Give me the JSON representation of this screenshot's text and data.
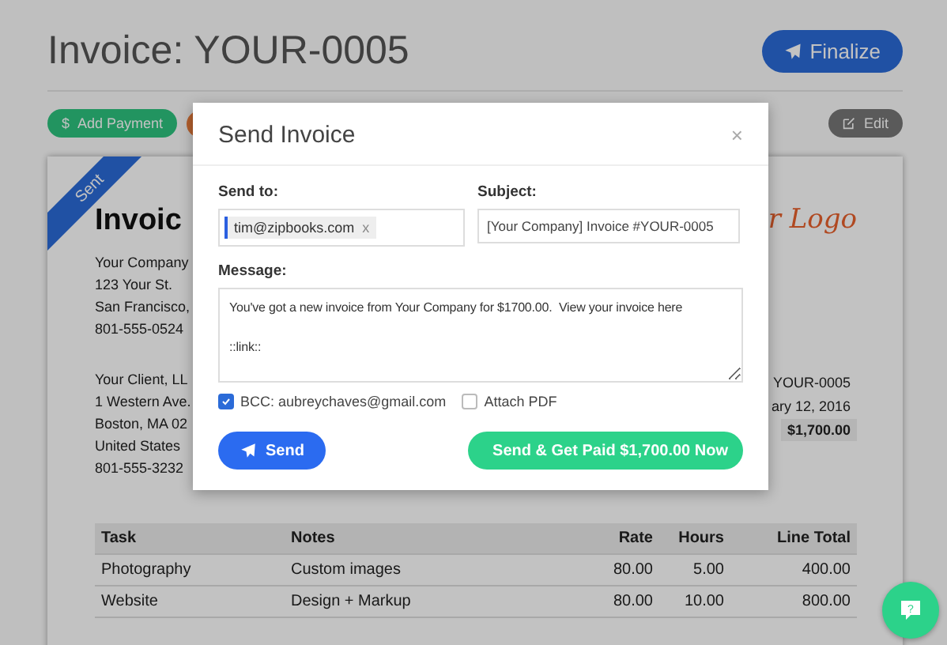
{
  "page": {
    "title": "Invoice: YOUR-0005",
    "finalize": "Finalize"
  },
  "actions": [
    {
      "kind": "payment",
      "icon": "$",
      "label": "Add Payment"
    },
    {
      "kind": "pdf"
    },
    {
      "kind": "edit",
      "label": "Edit"
    }
  ],
  "invoice": {
    "status": "Sent",
    "heading": "Invoic",
    "logo": "r Logo",
    "company": [
      "Your Company",
      "123 Your St.",
      "San Francisco,",
      "801-555-0524"
    ],
    "client": [
      "Your Client, LL",
      "1 Western Ave.",
      "Boston, MA 02",
      "United States",
      "801-555-3232"
    ],
    "meta": [
      {
        "text": "YOUR-0005",
        "highlight": false
      },
      {
        "text": "ary 12, 2016",
        "highlight": false
      },
      {
        "text": "$1,700.00",
        "highlight": true
      }
    ],
    "table": {
      "columns": [
        "Task",
        "Notes",
        "Rate",
        "Hours",
        "Line Total"
      ],
      "rows": [
        [
          "Photography",
          "Custom images",
          "80.00",
          "5.00",
          "400.00"
        ],
        [
          "Website",
          "Design + Markup",
          "80.00",
          "10.00",
          "800.00"
        ]
      ]
    }
  },
  "help": "?",
  "modal": {
    "title": "Send Invoice",
    "close": "×",
    "send_to_label": "Send to:",
    "recipients": [
      "tim@zipbooks.com"
    ],
    "remove": "x",
    "subject_label": "Subject:",
    "subject": "[Your Company] Invoice #YOUR-0005",
    "message_label": "Message:",
    "message": "You've got a new invoice from Your Company for $1700.00.  View your invoice here\n\n::link::",
    "options": [
      {
        "label": "BCC: aubreychaves@gmail.com",
        "checked": true
      },
      {
        "label": "Attach PDF",
        "checked": false
      }
    ],
    "send": "Send",
    "send_paid": "Send & Get Paid $1,700.00 Now"
  }
}
